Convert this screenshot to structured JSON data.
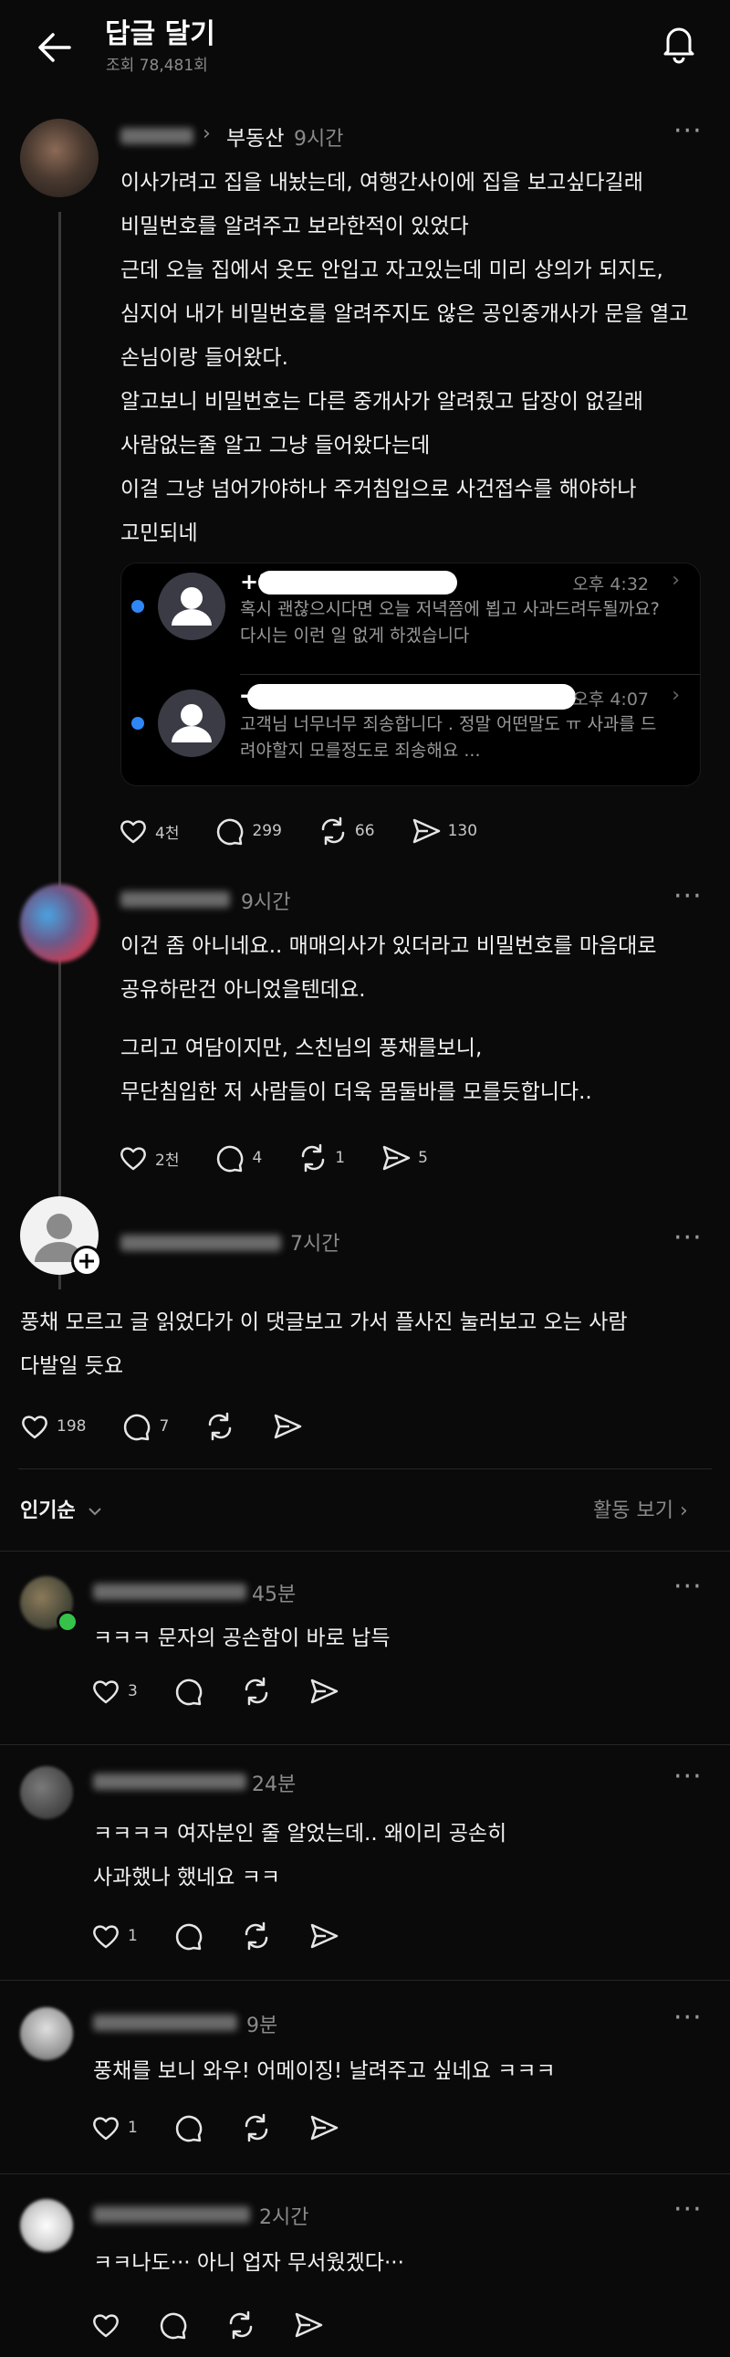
{
  "header": {
    "title": "답글 달기",
    "views": "조회 78,481회"
  },
  "main_post": {
    "topic": "부동산",
    "time": "9시간",
    "lines": [
      "이사가려고 집을 내놨는데, 여행간사이에 집을 보고싶다길래",
      "비밀번호를 알려주고 보라한적이 있었다",
      "근데 오늘 집에서 옷도 안입고 자고있는데 미리 상의가 되지도,",
      "심지어 내가 비밀번호를 알려주지도 않은 공인중개사가 문을 열고",
      "손님이랑 들어왔다.",
      "알고보니 비밀번호는 다른 중개사가 알려줬고 답장이 없길래",
      "사람없는줄 알고 그냥 들어왔다는데",
      "이걸 그냥 넘어가야하나 주거침입으로 사건접수를 해야하나",
      "고민되네"
    ],
    "messages": [
      {
        "number": "+8",
        "time": "오후 4:32",
        "text": "혹시 괜찮으시다면 오늘 저녁쯤에 뵙고 사과드려두될까요? 다시는 이런 일 없게 하겠습니다"
      },
      {
        "number": "-",
        "time": "오후 4:07",
        "text": "고객님 너무너무 죄송합니다 . 정말 어떤말도 ㅠ 사과를 드려야할지 모를정도로 죄송해요 ..."
      }
    ],
    "likes": "4천",
    "comments": "299",
    "reposts": "66",
    "shares": "130"
  },
  "reply1": {
    "time": "9시간",
    "lines": [
      "이건 좀 아니네요.. 매매의사가 있더라고 비밀번호를 마음대로",
      "공유하란건 아니었을텐데요.",
      "그리고 여담이지만, 스친님의 풍채를보니,",
      "무단침입한 저 사람들이 더욱 몸둘바를 모를듯합니다.."
    ],
    "likes": "2천",
    "comments": "4",
    "reposts": "1",
    "shares": "5"
  },
  "reply2": {
    "time": "7시간",
    "lines": [
      "풍채 모르고 글 읽었다가 이 댓글보고 가서 플사진 눌러보고 오는 사람",
      "다발일 듯요"
    ],
    "likes": "198",
    "comments": "7"
  },
  "sort": {
    "label": "인기순",
    "activity": "활동 보기"
  },
  "comments": [
    {
      "time": "45분",
      "lines": [
        "ㅋㅋㅋ 문자의 공손함이 바로 납득"
      ],
      "likes": "3"
    },
    {
      "time": "24분",
      "lines": [
        "ㅋㅋㅋㅋ 여자분인 줄 알었는데.. 왜이리 공손히",
        "사과했나 했네요 ㅋㅋ"
      ],
      "likes": "1"
    },
    {
      "time": "9분",
      "lines": [
        "풍채를 보니 와우! 어메이징! 날려주고 싶네요 ㅋㅋㅋ"
      ],
      "likes": "1"
    },
    {
      "time": "2시간",
      "lines": [
        "ㅋㅋ나도··· 아니 업자 무서웠겠다···"
      ],
      "likes": ""
    }
  ],
  "colors": {
    "background": "#0a0a0a",
    "accent_blue": "#2f86f6",
    "text": "#f2f2f2",
    "muted": "#8a8a8a"
  }
}
